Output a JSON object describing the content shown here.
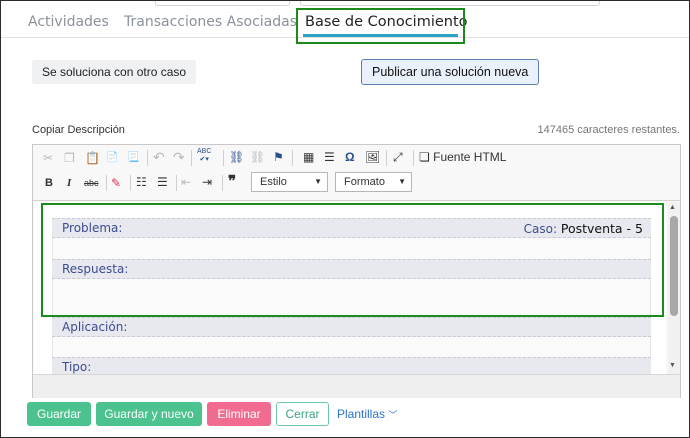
{
  "tabs": [
    {
      "label": "Actividades"
    },
    {
      "label": "Transacciones Asociadas"
    },
    {
      "label": "Base de Conocimiento"
    }
  ],
  "actions": {
    "other_case": "Se soluciona con otro caso",
    "publish_new": "Publicar una solución nueva"
  },
  "description": {
    "label": "Copiar Descripción",
    "chars_remaining": "147465 caracteres restantes."
  },
  "toolbar": {
    "source_html": "Fuente HTML",
    "style_label": "Estilo",
    "format_label": "Formato",
    "bold": "B",
    "italic": "I",
    "strike": "abc",
    "spell": "ABC",
    "blockquote": "❞",
    "omega": "Ω",
    "icons": [
      "cut-icon",
      "copy-icon",
      "paste-icon",
      "paste-text-icon",
      "paste-word-icon",
      "undo-icon",
      "redo-icon",
      "spellcheck-icon",
      "link-icon",
      "unlink-icon",
      "anchor-icon",
      "table-icon",
      "hr-icon",
      "special-char-icon",
      "image-icon",
      "maximize-icon",
      "source-icon",
      "remove-format-icon",
      "numbered-list-icon",
      "bulleted-list-icon",
      "outdent-icon",
      "indent-icon"
    ]
  },
  "sections": {
    "problema": "Problema:",
    "caso_label": "Caso:",
    "caso_value": "Postventa - 5",
    "respuesta": "Respuesta:",
    "aplicacion": "Aplicación:",
    "tipo": "Tipo:"
  },
  "footer": {
    "save": "Guardar",
    "save_new": "Guardar y nuevo",
    "delete": "Eliminar",
    "close": "Cerrar",
    "templates": "Plantillas"
  },
  "colors": {
    "accent": "#2aa3c5",
    "highlight": "#1c8a1c",
    "save": "#4cc28e",
    "delete": "#f06b8f",
    "section_text": "#3d4c8f"
  }
}
